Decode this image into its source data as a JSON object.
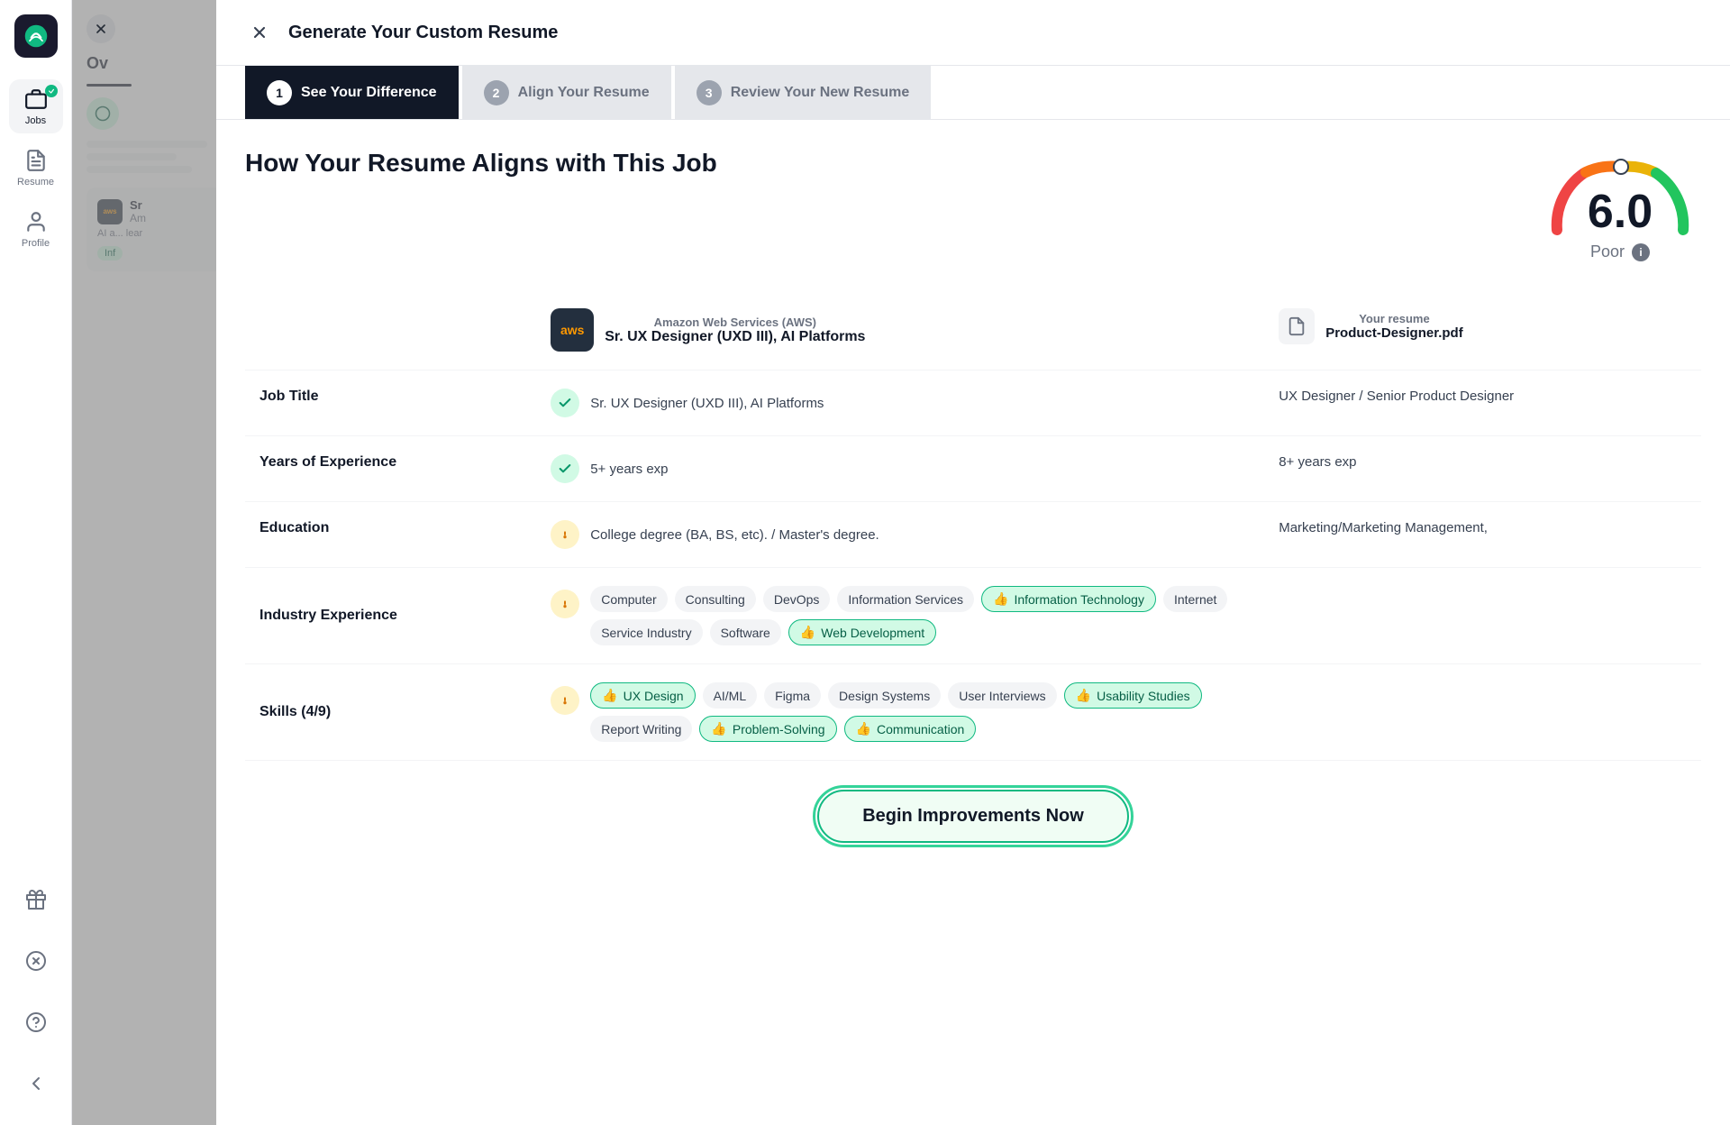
{
  "sidebar": {
    "logo_alt": "JobScan logo",
    "items": [
      {
        "id": "jobs",
        "label": "Jobs",
        "active": true,
        "has_badge": true
      },
      {
        "id": "resume",
        "label": "Resume",
        "active": false,
        "has_badge": false
      },
      {
        "id": "profile",
        "label": "Profile",
        "active": false,
        "has_badge": false
      }
    ],
    "bottom_items": [
      {
        "id": "gift",
        "label": ""
      },
      {
        "id": "x",
        "label": ""
      },
      {
        "id": "help",
        "label": ""
      },
      {
        "id": "back",
        "label": ""
      }
    ]
  },
  "modal": {
    "close_label": "×",
    "title": "Generate Your Custom Resume",
    "steps": [
      {
        "number": "1",
        "label": "See Your Difference",
        "active": true
      },
      {
        "number": "2",
        "label": "Align Your Resume",
        "active": false
      },
      {
        "number": "3",
        "label": "Review Your New Resume",
        "active": false
      }
    ],
    "page_title": "How Your Resume Aligns with This Job",
    "score": "6.0",
    "score_label": "Poor",
    "job": {
      "company": "Amazon Web Services (AWS)",
      "title": "Sr. UX Designer (UXD III), AI Platforms",
      "logo_text": "aws"
    },
    "resume": {
      "label": "Your resume",
      "filename": "Product-Designer.pdf"
    },
    "rows": [
      {
        "id": "job-title",
        "label": "Job Title",
        "status": "green",
        "job_value": "Sr. UX Designer (UXD III), AI Platforms",
        "resume_value": "UX Designer / Senior Product Designer"
      },
      {
        "id": "years-experience",
        "label": "Years of Experience",
        "status": "green",
        "job_value": "5+ years exp",
        "resume_value": "8+ years exp"
      },
      {
        "id": "education",
        "label": "Education",
        "status": "orange",
        "job_value": "College degree (BA, BS, etc). / Master's degree.",
        "resume_value": "Marketing/Marketing Management,"
      },
      {
        "id": "industry-experience",
        "label": "Industry Experience",
        "status": "orange",
        "job_tags": [
          {
            "text": "Computer",
            "highlight": false
          },
          {
            "text": "Consulting",
            "highlight": false
          },
          {
            "text": "DevOps",
            "highlight": false
          },
          {
            "text": "Information Services",
            "highlight": false
          },
          {
            "text": "Information Technology",
            "highlight": true
          },
          {
            "text": "Internet",
            "highlight": false
          },
          {
            "text": "Service Industry",
            "highlight": false
          },
          {
            "text": "Software",
            "highlight": false
          },
          {
            "text": "Web Development",
            "highlight": true
          }
        ],
        "resume_value": ""
      },
      {
        "id": "skills",
        "label": "Skills (4/9)",
        "status": "orange",
        "job_tags": [
          {
            "text": "UX Design",
            "highlight": true
          },
          {
            "text": "AI/ML",
            "highlight": false
          },
          {
            "text": "Figma",
            "highlight": false
          },
          {
            "text": "Design Systems",
            "highlight": false
          },
          {
            "text": "User Interviews",
            "highlight": false
          },
          {
            "text": "Usability Studies",
            "highlight": true
          },
          {
            "text": "Report Writing",
            "highlight": false
          },
          {
            "text": "Problem-Solving",
            "highlight": true
          },
          {
            "text": "Communication",
            "highlight": true
          }
        ],
        "resume_value": ""
      }
    ],
    "cta_label": "Begin Improvements Now"
  },
  "job_panel": {
    "title": "Ov",
    "job_title_short": "Sr",
    "company_short": "Am",
    "description_short": "AI a... lear",
    "info_label": "Inf"
  }
}
